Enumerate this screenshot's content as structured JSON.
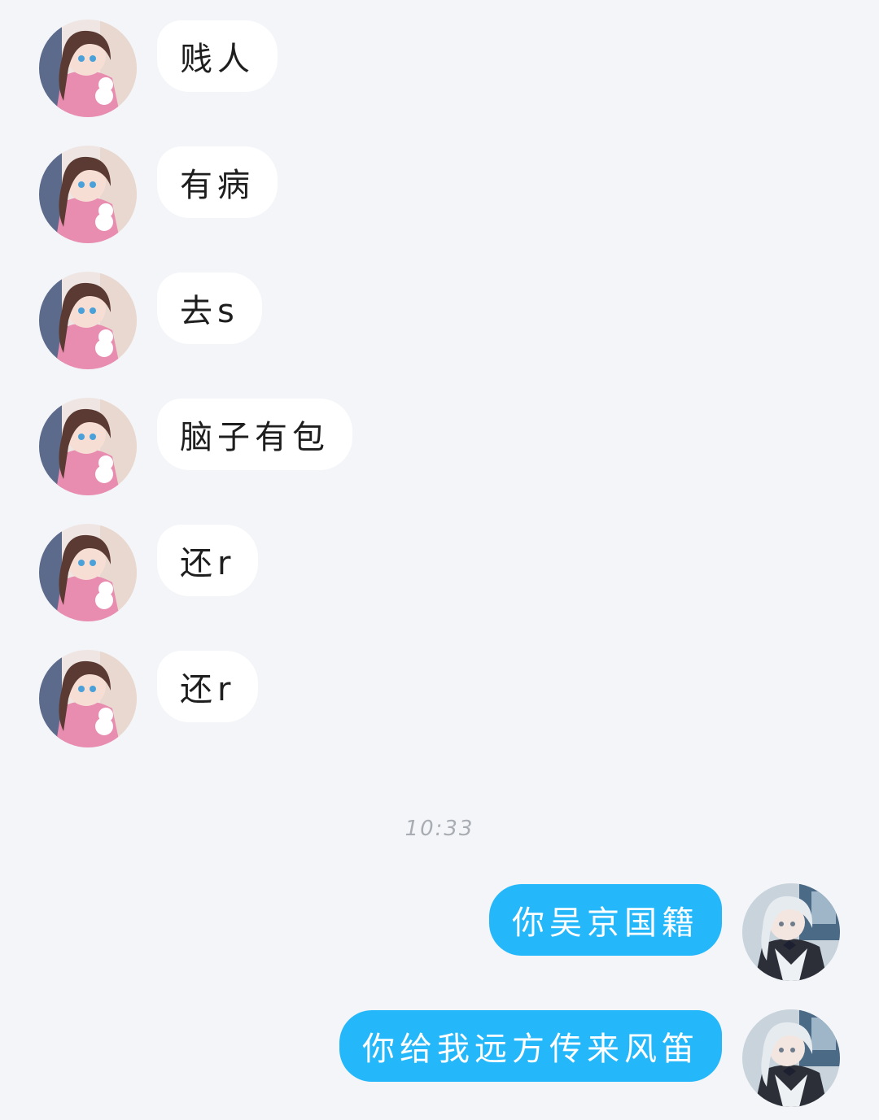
{
  "conversation": {
    "incoming": [
      {
        "text": "贱人"
      },
      {
        "text": "有病"
      },
      {
        "text": "去s"
      },
      {
        "text": "脑子有包"
      },
      {
        "text": "还r"
      },
      {
        "text": "还r"
      }
    ],
    "timestamp": "10:33",
    "outgoing": [
      {
        "text": "你吴京国籍"
      },
      {
        "text": "你给我远方传来风笛"
      }
    ]
  },
  "colors": {
    "background": "#f3f5f8",
    "incoming_bubble": "#ffffff",
    "outgoing_bubble": "#24b7fa",
    "timestamp_text": "#a9adb3"
  }
}
